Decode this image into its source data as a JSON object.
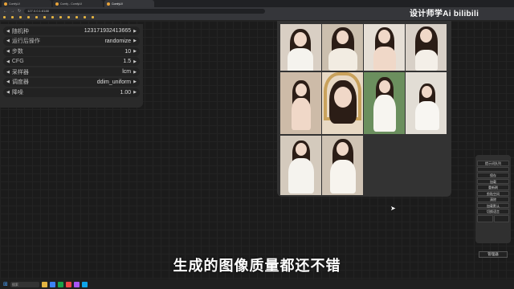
{
  "browser": {
    "tabs": [
      {
        "title": "ComfyUI"
      },
      {
        "title": "Comfy - ComfyUI"
      },
      {
        "title": "ComfyUI"
      }
    ],
    "url": "127.0.0.1:8188"
  },
  "bookmarks": [
    "",
    "",
    "",
    "",
    "",
    "",
    "",
    "",
    "",
    "",
    "",
    ""
  ],
  "brand": "设计师学Ai bilibili",
  "params": [
    {
      "label": "随机种",
      "value": "123171932413665"
    },
    {
      "label": "运行后操作",
      "value": "randomize"
    },
    {
      "label": "步数",
      "value": "10"
    },
    {
      "label": "CFG",
      "value": "1.5"
    },
    {
      "label": "采样器",
      "value": "lcm"
    },
    {
      "label": "调度器",
      "value": "ddim_uniform"
    },
    {
      "label": "降噪",
      "value": "1.00"
    }
  ],
  "menu": {
    "title": "",
    "buttons": [
      "提示词队列",
      "",
      "保存",
      "加载",
      "重新刷",
      "剪贴空间",
      "清除",
      "加载默认",
      "切换语言"
    ],
    "small_buttons": [
      "",
      ""
    ],
    "manager": "管理器"
  },
  "subtitle": "生成的图像质量都还不错",
  "taskbar": {
    "search": "搜索",
    "time": "",
    "date": ""
  },
  "icons": {
    "back": "back-icon",
    "forward": "forward-icon",
    "reload": "reload-icon",
    "arrow_left": "left-arrow-icon",
    "arrow_right": "right-arrow-icon",
    "cursor": "cursor-icon",
    "windows": "windows-icon"
  }
}
